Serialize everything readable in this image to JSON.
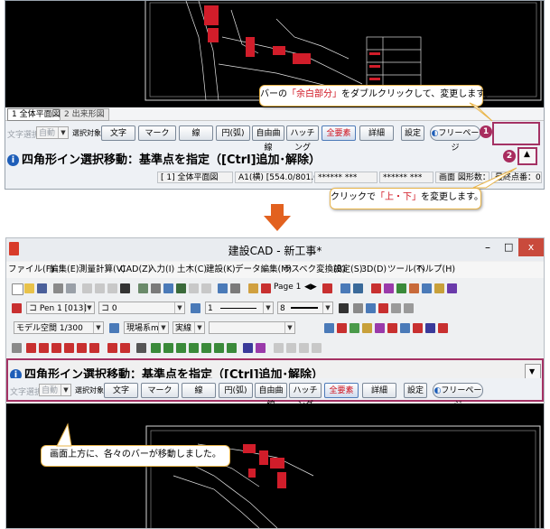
{
  "top": {
    "tabs": [
      {
        "label": "1 全体平面図"
      },
      {
        "label": "2 出来形図"
      }
    ],
    "cmd": {
      "text_select_label": "文字選択",
      "text_select_value": "自動",
      "target_label": "選択対象",
      "buttons": [
        {
          "label": "文字"
        },
        {
          "label": "マーク"
        },
        {
          "label": "線"
        },
        {
          "label": "円(弧)"
        },
        {
          "label": "自由曲線"
        },
        {
          "label": "ハッチング"
        },
        {
          "label": "全要素"
        },
        {
          "label": "詳細"
        }
      ],
      "settings": "設定",
      "freepage": "フリーページ"
    },
    "status_message": "四角形イン選択移動：基準点を指定（[Ctrl]追加･解除）",
    "statusbar": {
      "drawing": "[ 1] 全体平面図",
      "scale": "A1(横) [554.0/801.0]",
      "coord1": "****** ***",
      "coord2": "****** ***",
      "count": "画面 図形数：0",
      "nearest": "最終点番：0"
    }
  },
  "annotations": {
    "callout1_parts": [
      "バーの",
      "「余白部分」",
      "をダブルクリックして、変更します。"
    ],
    "callout2_parts": [
      "クリックで",
      "「上・下」",
      "を変更します。"
    ],
    "callout3": "画面上方に、各々のバーが移動しました。",
    "badge1": "1",
    "badge2": "2"
  },
  "bottom": {
    "title": "建設CAD - 新工事*",
    "menu": [
      "ファイル(F)",
      "編集(E)",
      "測量計算(V)",
      "CAD(Z)",
      "入力(I)",
      "土木(C)",
      "建設(K)",
      "データ編集(M)",
      "ラスベク変換(B)",
      "設定(S)",
      "3D(D)",
      "ツール(T)",
      "ヘルプ(H)"
    ],
    "toolbar1": {
      "page_label": "Page 1"
    },
    "toolbar2": {
      "pen": "コ Pen 1 [013]",
      "layer": "コ 0",
      "line": "1",
      "weight": "8"
    },
    "toolbar3": {
      "space": "モデル空間 1/300",
      "unit": "現場系m",
      "linetype": "実線"
    },
    "status_message": "四角形イン選択移動：基準点を指定（[Ctrl]追加･解除）",
    "cmd": {
      "text_select_label": "文字選択",
      "text_select_value": "自動",
      "target_label": "選択対象",
      "buttons": [
        {
          "label": "文字"
        },
        {
          "label": "マーク"
        },
        {
          "label": "線"
        },
        {
          "label": "円(弧)"
        },
        {
          "label": "自由曲線"
        },
        {
          "label": "ハッチング"
        },
        {
          "label": "全要素"
        },
        {
          "label": "詳細"
        }
      ],
      "settings": "設定",
      "freepage": "フリーページ"
    }
  },
  "colors": {
    "accent_red": "#a43264",
    "info_blue": "#1e5eb8",
    "close_red": "#c94a3c",
    "callout_border": "#e9b54a",
    "arrow_orange": "#e2611f"
  }
}
